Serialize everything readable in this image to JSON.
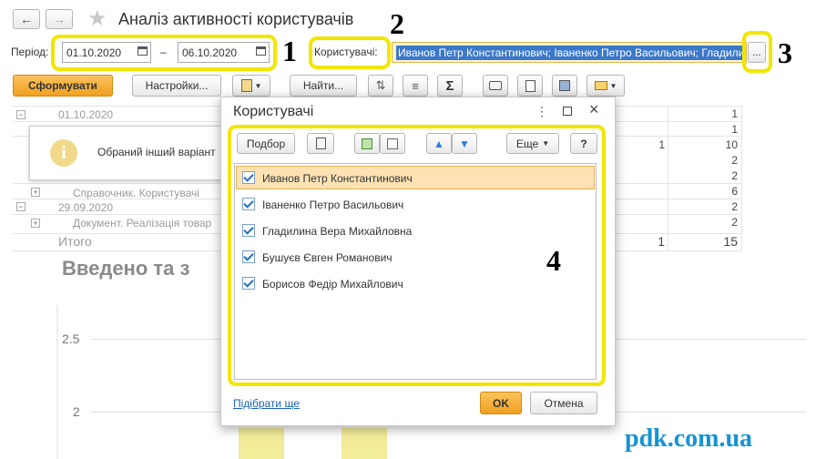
{
  "window": {
    "title": "Аналіз активності користувачів"
  },
  "filters": {
    "period_label": "Період:",
    "date_from": "01.10.2020",
    "date_sep": "–",
    "date_to": "06.10.2020",
    "users_label": "Користувачі:",
    "users_value": "Иванов  Петр  Константинович; Іваненко Петро Васильович; Гладилина Вера Михайловна; Бушуєв Євген Романович; Борисов Федір Михайлович",
    "select_button": "..."
  },
  "toolbar": {
    "generate": "Сформувати",
    "settings": "Настройки...",
    "find": "Найти..."
  },
  "annotations": {
    "n1": "1",
    "n2": "2",
    "n3": "3",
    "n4": "4"
  },
  "report": {
    "row_date1": "01.10.2020",
    "row_directory": "Справочник. Користувачі",
    "row_date2": "29.09.2020",
    "row_document": "Документ. Реалізація товар",
    "total_label": "Итого",
    "col_a": [
      "",
      "",
      "1",
      "",
      "",
      "",
      "",
      "",
      "1"
    ],
    "col_b": [
      "1",
      "1",
      "10",
      "2",
      "2",
      "6",
      "2",
      "2",
      "15"
    ],
    "chart_title": "Введено та з",
    "axis_ticks": [
      "2.5",
      "2"
    ]
  },
  "notification": {
    "text": "Обраний інший варіант"
  },
  "dialog": {
    "title": "Користувачі",
    "pick_button": "Подбор",
    "more_button": "Еще",
    "help_button": "?",
    "items": [
      {
        "name": "Иванов  Петр  Константинович",
        "checked": true
      },
      {
        "name": "Іваненко Петро Васильович",
        "checked": true
      },
      {
        "name": "Гладилина Вера Михайловна",
        "checked": true
      },
      {
        "name": "Бушуєв Євген Романович",
        "checked": true
      },
      {
        "name": "Борисов Федір Михайлович",
        "checked": true
      }
    ],
    "pick_more_link": "Підібрати ще",
    "ok_button": "OK",
    "cancel_button": "Отмена"
  },
  "watermark": "pdk.com.ua",
  "colors": {
    "accent": "#f5a623",
    "highlight": "#f2e600",
    "selected_row": "#fde3b4",
    "link": "#1a62b8"
  }
}
